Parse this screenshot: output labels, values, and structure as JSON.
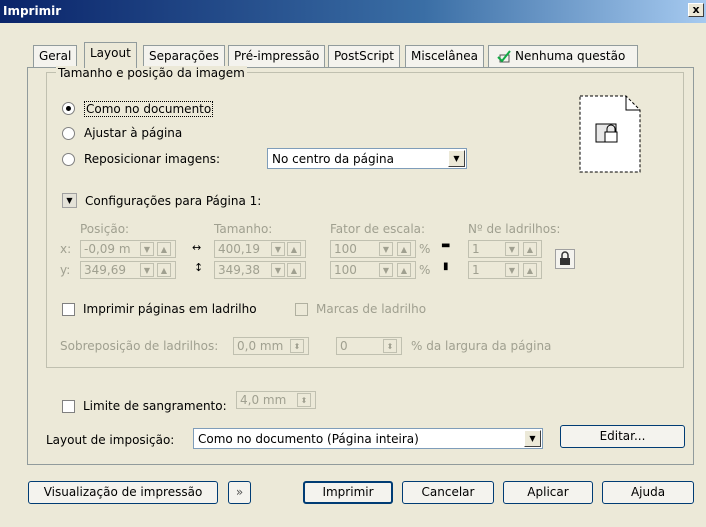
{
  "window": {
    "title": "Imprimir",
    "close": "x"
  },
  "tabs": [
    "Geral",
    "Layout",
    "Separações",
    "Pré-impressão",
    "PostScript",
    "Miscelânea",
    "Nenhuma questão"
  ],
  "group": {
    "title": "Tamanho e posição da imagem",
    "radios": [
      "Como no documento",
      "Ajustar à página",
      "Reposicionar imagens:"
    ],
    "reposition_value": "No centro da página",
    "config_title": "Configurações para Página 1:",
    "headers": {
      "pos": "Posição:",
      "size": "Tamanho:",
      "scale": "Fator de escala:",
      "tiles": "Nº de ladrilhos:"
    },
    "rows": [
      {
        "axis": "x:",
        "pos": "-0,09 m",
        "size": "400,19",
        "scale": "100",
        "pct": "%",
        "tiles": "1"
      },
      {
        "axis": "y:",
        "pos": "349,69",
        "size": "349,38",
        "scale": "100",
        "pct": "%",
        "tiles": "1"
      }
    ],
    "tile_print": "Imprimir páginas em ladrilho",
    "tile_marks": "Marcas de ladrilho",
    "overlap_label": "Sobreposição de ladrilhos:",
    "overlap_mm": "0,0 mm",
    "overlap_pct": "0",
    "overlap_suffix": "% da largura da página"
  },
  "bleed": {
    "label": "Limite de sangramento:",
    "value": "4,0 mm"
  },
  "imposition": {
    "label": "Layout de imposição:",
    "value": "Como no documento (Página inteira)",
    "edit": "Editar..."
  },
  "bottom": {
    "preview": "Visualização de impressão",
    "print": "Imprimir",
    "cancel": "Cancelar",
    "apply": "Aplicar",
    "help": "Ajuda"
  }
}
